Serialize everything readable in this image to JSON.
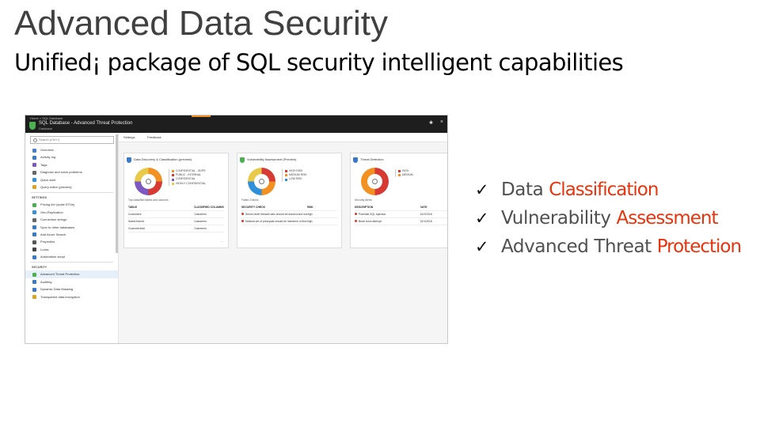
{
  "slide": {
    "title": "Advanced Data Security",
    "subtitle": "Unified¡ package of SQL security intelligent capabilities"
  },
  "checklist": [
    {
      "check_glyph": "✓",
      "prefix": "Data",
      "highlight": "Classification"
    },
    {
      "check_glyph": "✓",
      "prefix": "Vulnerability",
      "highlight": "Assessment"
    },
    {
      "check_glyph": "✓",
      "prefix": "Advanced Threat",
      "highlight": "Protection"
    }
  ],
  "colors": {
    "highlight": "#e8340d",
    "title": "#404040",
    "portal_topbar": "#1e1e1e",
    "logo_green": "#4caf50"
  },
  "screenshot": {
    "breadcrumb": "Home > SQL Database",
    "window_title": "SQL Database - Advanced Threat Protection",
    "window_subtitle": "Database",
    "pin_glyph": "✱",
    "close_glyph": "×",
    "sidebar": {
      "search_placeholder": "Search (Ctrl+/)",
      "items_top": [
        {
          "label": "Overview",
          "icon": "overview-icon",
          "color": "#4a7fd0"
        },
        {
          "label": "Activity log",
          "icon": "activity-log-icon",
          "color": "#3a78c8"
        },
        {
          "label": "Tags",
          "icon": "tag-icon",
          "color": "#7b59c0"
        },
        {
          "label": "Diagnose and solve problems",
          "icon": "wrench-icon",
          "color": "#666666"
        },
        {
          "label": "Quick start",
          "icon": "cloud-icon",
          "color": "#2f8fd8"
        },
        {
          "label": "Query editor (preview)",
          "icon": "editor-icon",
          "color": "#d9a321"
        }
      ],
      "settings_header": "SETTINGS",
      "items_settings": [
        {
          "label": "Pricing tier (scale DTUs)",
          "icon": "pricing-icon",
          "color": "#4caf50"
        },
        {
          "label": "Geo-Replication",
          "icon": "globe-icon",
          "color": "#3a8fd8"
        },
        {
          "label": "Connection strings",
          "icon": "connection-icon",
          "color": "#666666"
        },
        {
          "label": "Sync to other databases",
          "icon": "sync-icon",
          "color": "#3a78c8"
        },
        {
          "label": "Add Azure Search",
          "icon": "search-plus-icon",
          "color": "#3a78c8"
        },
        {
          "label": "Properties",
          "icon": "properties-icon",
          "color": "#555555"
        },
        {
          "label": "Locks",
          "icon": "lock-icon",
          "color": "#444444"
        },
        {
          "label": "Automation script",
          "icon": "script-icon",
          "color": "#3a78c8"
        }
      ],
      "security_header": "SECURITY",
      "items_security": [
        {
          "label": "Advanced Threat Protection",
          "icon": "shield-icon",
          "color": "#4caf50",
          "active": true
        },
        {
          "label": "Auditing",
          "icon": "audit-icon",
          "color": "#3a78c8",
          "active": false
        },
        {
          "label": "Dynamic Data Masking",
          "icon": "mask-icon",
          "color": "#3a78c8",
          "active": false
        },
        {
          "label": "Transparent data encryption",
          "icon": "encryption-icon",
          "color": "#d9a321",
          "active": false
        }
      ]
    },
    "toolbar": {
      "settings": "Settings",
      "feedback": "Feedback"
    },
    "panels": [
      {
        "title": "Data Discovery & Classification (preview)",
        "icon_color": "#3a78c8",
        "donut": [
          "#f29022",
          "#d63a32",
          "#7b59c0",
          "#e8c94a"
        ],
        "legend": [
          {
            "text": "CONFIDENTIAL - GDPR",
            "color": "#f29022"
          },
          {
            "text": "PUBLIC - INTERNAL",
            "color": "#d63a32"
          },
          {
            "text": "CONFIDENTIAL",
            "color": "#7b59c0"
          },
          {
            "text": "HIGHLY CONFIDENTIAL",
            "color": "#e8c94a"
          }
        ],
        "sub_label": "Top classified tables and columns",
        "columns": [
          "TABLE",
          "CLASSIFIED COLUMNS"
        ],
        "rows": [
          {
            "name": "Customers",
            "value": "Customers"
          },
          {
            "name": "SalesOrderId",
            "value": "Customers"
          },
          {
            "name": "CustomerAdd",
            "value": "Customers"
          }
        ],
        "button": "..."
      },
      {
        "title": "Vulnerability Assessment (Preview)",
        "icon_color": "#4caf50",
        "donut": [
          "#d63a32",
          "#f29022",
          "#2f8fd8",
          "#e8c94a"
        ],
        "legend": [
          {
            "text": "HIGH RISK",
            "color": "#d63a32"
          },
          {
            "text": "MEDIUM RISK",
            "color": "#f29022"
          },
          {
            "text": "LOW RISK",
            "color": "#2f8fd8"
          }
        ],
        "sub_label": "Failed Checks",
        "columns": [
          "SECURITY CHECK",
          "RISK"
        ],
        "rows": [
          {
            "name": "Server-level firewall rules should be tracked and maintained",
            "value": "High"
          },
          {
            "name": "Minimal set of principals should be members of fixed server roles",
            "value": "High"
          }
        ],
        "button": ""
      },
      {
        "title": "Threat Detection",
        "icon_color": "#3a78c8",
        "donut": [
          "#d63a32",
          "#f29022"
        ],
        "legend": [
          {
            "text": "HIGH",
            "color": "#d63a32"
          },
          {
            "text": "MEDIUM",
            "color": "#f29022"
          }
        ],
        "sub_label": "Security Alerts",
        "columns": [
          "DESCRIPTION",
          "DATE"
        ],
        "rows": [
          {
            "name": "Potential SQL Injection",
            "value": "10/2/2018"
          },
          {
            "name": "Brute force attempt",
            "value": "10/1/2018"
          }
        ],
        "button": ""
      }
    ]
  }
}
